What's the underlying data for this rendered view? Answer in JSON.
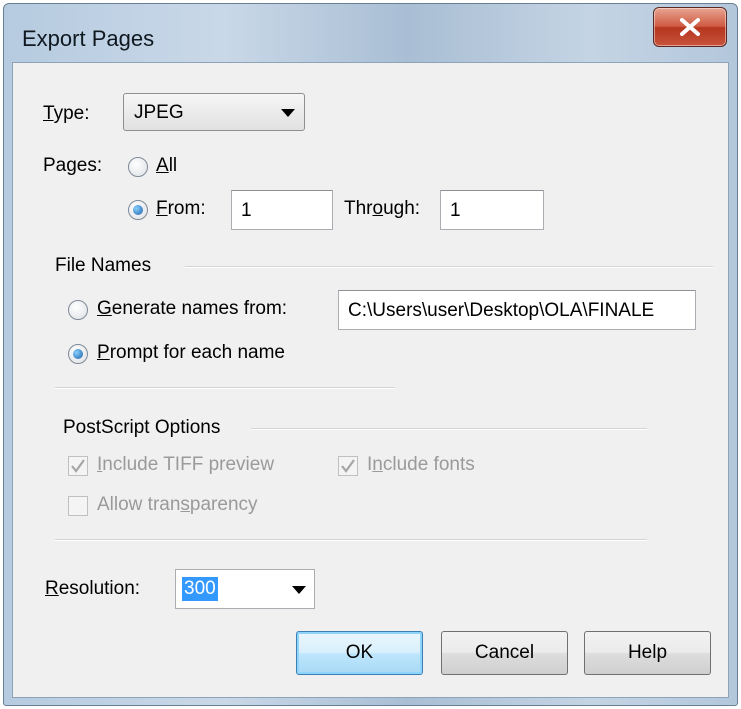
{
  "window": {
    "title": "Export Pages"
  },
  "type_field": {
    "label_prefix": "",
    "label_mnemonic": "T",
    "label_rest": "ype:",
    "value": "JPEG"
  },
  "pages": {
    "label": "Pages:",
    "all_mnemonic": "A",
    "all_rest": "ll",
    "from_mnemonic": "F",
    "from_rest": "rom:",
    "from_value": "1",
    "through_prefix": "Thr",
    "through_mnemonic": "o",
    "through_rest": "ugh:",
    "through_value": "1",
    "selected": "from"
  },
  "file_names": {
    "group_title": "File Names",
    "generate_mnemonic": "G",
    "generate_rest": "enerate names from:",
    "path_value": "C:\\Users\\user\\Desktop\\OLA\\FINALE",
    "prompt_mnemonic": "P",
    "prompt_rest": "rompt for each name",
    "selected": "prompt"
  },
  "postscript": {
    "group_title": "PostScript Options",
    "tiff_prefix": "",
    "tiff_mnemonic": "I",
    "tiff_rest": "nclude TIFF preview",
    "fonts_prefix": "I",
    "fonts_mnemonic": "n",
    "fonts_rest": "clude fonts",
    "transparency_prefix": "Allow tran",
    "transparency_mnemonic": "s",
    "transparency_rest": "parency",
    "tiff_checked": true,
    "fonts_checked": true,
    "transparency_checked": false,
    "enabled": false
  },
  "resolution": {
    "label_mnemonic": "R",
    "label_rest": "esolution:",
    "value": "300"
  },
  "buttons": {
    "ok": "OK",
    "cancel": "Cancel",
    "help": "Help"
  },
  "colors": {
    "selection": "#3399ff",
    "close_button": "#c9533b",
    "default_button_border": "#3c7fb1"
  }
}
